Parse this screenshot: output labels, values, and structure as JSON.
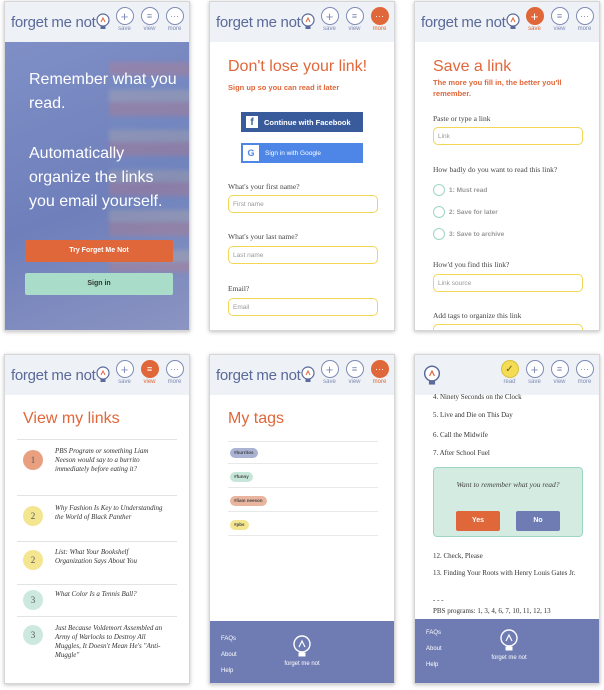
{
  "brand": "forget me not",
  "nav": {
    "save": "save",
    "view": "view",
    "more": "more",
    "read": "read"
  },
  "landing": {
    "headline1": "Remember what you read.",
    "headline2": "Automatically organize the links you email yourself.",
    "cta_primary": "Try Forget Me Not",
    "cta_secondary": "Sign in"
  },
  "signup": {
    "title": "Don't lose your link!",
    "subtitle": "Sign up so you can read it later",
    "facebook": "Continue with Facebook",
    "google": "Sign in with Google",
    "first_label": "What's your first name?",
    "first_ph": "First name",
    "last_label": "What's your last name?",
    "last_ph": "Last name",
    "email_label": "Email?",
    "email_ph": "Email"
  },
  "save": {
    "title": "Save a link",
    "subtitle": "The more you fill in, the better you'll remember.",
    "paste_label": "Paste or type a link",
    "link_ph": "Link",
    "priority_label": "How badly do you want to read this link?",
    "options": [
      "1: Must read",
      "2: Save for later",
      "3: Save to archive"
    ],
    "source_label": "How'd you find this link?",
    "source_ph": "Link source",
    "tags_label": "Add tags to organize this link"
  },
  "view": {
    "title": "View my links",
    "links": [
      {
        "num": "1",
        "text": "PBS Program or something Liam Neeson would say to a burrito immediately before eating it?"
      },
      {
        "num": "2",
        "text": "Why Fashion Is Key to Understanding the World of Black Panther"
      },
      {
        "num": "2",
        "text": "List: What Your Bookshelf Organization Says About You"
      },
      {
        "num": "3",
        "text": "What Color Is a Tennis Ball?"
      },
      {
        "num": "3",
        "text": "Just Because Voldemort Assembled an Army of Warlocks to Destroy All Muggles, It Doesn't Mean He's \"Anti-Muggle\""
      }
    ]
  },
  "tags": {
    "title": "My tags",
    "items": [
      "#burritos",
      "#funny",
      "#liam neeson",
      "#pbs"
    ]
  },
  "footer": {
    "faqs": "FAQs",
    "about": "About",
    "help": "Help"
  },
  "article": {
    "lines": [
      "4. Ninety Seconds on the Clock",
      "5. Live and Die on This Day",
      "6. Call the Midwife",
      "7. After School Fuel"
    ],
    "popup_q": "Want to remember what you read?",
    "yes": "Yes",
    "no": "No",
    "after": [
      "12. Check, Please",
      "13. Finding Your Roots with Henry Louis Gates Jr.",
      "- - -",
      "PBS programs: 1, 3, 4, 6, 7, 10, 11, 12, 13"
    ]
  },
  "colors": {
    "orange": "#e0673a",
    "indigo": "#6f7cb3",
    "mint": "#a9dcc9",
    "yellow": "#f2d655"
  }
}
